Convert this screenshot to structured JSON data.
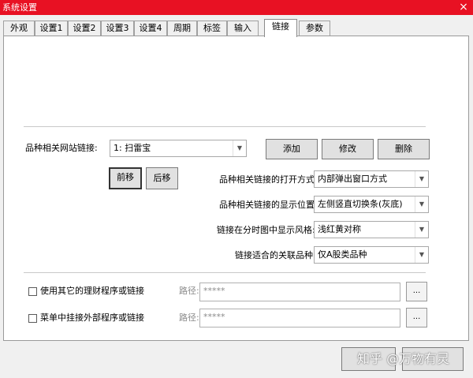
{
  "window": {
    "title": "系统设置",
    "close_glyph": "×"
  },
  "tabs": [
    {
      "label": "外观"
    },
    {
      "label": "设置1"
    },
    {
      "label": "设置2"
    },
    {
      "label": "设置3"
    },
    {
      "label": "设置4"
    },
    {
      "label": "周期"
    },
    {
      "label": "标签"
    },
    {
      "label": "输入"
    },
    {
      "label": "链接",
      "active": true
    },
    {
      "label": "参数"
    }
  ],
  "link": {
    "website_label": "品种相关网站链接:",
    "website_value": "1: 扫雷宝",
    "add_label": "添加",
    "edit_label": "修改",
    "delete_label": "删除",
    "move_up_label": "前移",
    "move_down_label": "后移",
    "open_mode_label": "品种相关链接的打开方式:",
    "open_mode_value": "内部弹出窗口方式",
    "display_pos_label": "品种相关链接的显示位置:",
    "display_pos_value": "左侧竖直切换条(灰底)",
    "minute_style_label": "链接在分时图中显示风格:",
    "minute_style_value": "浅红黄对称",
    "suitable_label": "链接适合的关联品种:",
    "suitable_value": "仅A股类品种"
  },
  "external": {
    "other_program_label": "使用其它的理财程序或链接",
    "menu_external_label": "菜单中挂接外部程序或链接",
    "path_label": "路径:",
    "path_value": "*****",
    "browse_label": "..."
  },
  "watermark": "知乎 @万物有灵",
  "icons": {
    "dropdown": "▼"
  }
}
